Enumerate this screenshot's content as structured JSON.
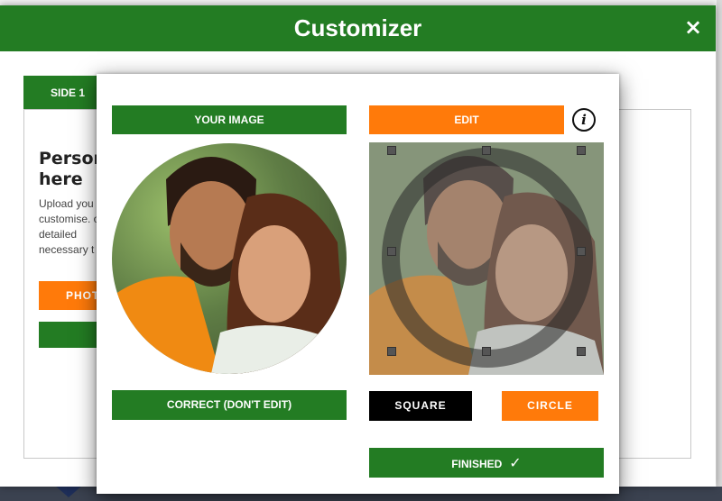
{
  "dialog": {
    "title": "Customizer",
    "close_icon": "×"
  },
  "background_panel": {
    "tab_label": "SIDE 1",
    "heading": "Person here",
    "description": "Upload you customise. or detailed necessary t",
    "orange_button_label": "PHOT"
  },
  "editor": {
    "your_image_label": "YOUR IMAGE",
    "edit_label": "EDIT",
    "info_icon": "i",
    "correct_label": "CORRECT (DON'T EDIT)",
    "square_label": "SQUARE",
    "circle_label": "CIRCLE",
    "finished_label": "FINISHED",
    "check_icon": "✓"
  },
  "colors": {
    "green": "#237c23",
    "orange": "#ff7a0a",
    "black": "#000000"
  }
}
